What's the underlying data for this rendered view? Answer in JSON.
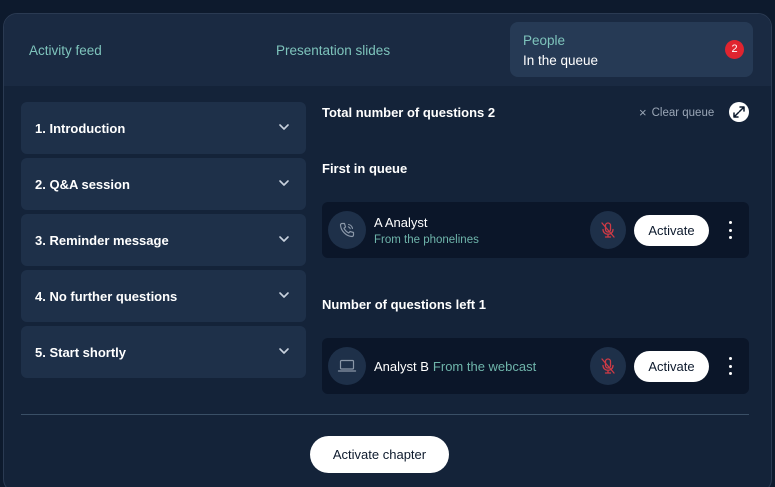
{
  "tabs": {
    "activity": "Activity feed",
    "slides": "Presentation slides",
    "people_title": "People",
    "people_subtitle": "In the queue",
    "people_badge": "2"
  },
  "chapters": [
    {
      "label": "1. Introduction"
    },
    {
      "label": "2. Q&A session"
    },
    {
      "label": "3. Reminder message"
    },
    {
      "label": "4. No further questions"
    },
    {
      "label": "5. Start shortly"
    }
  ],
  "queue": {
    "total_label": "Total number of questions 2",
    "clear_label": "Clear queue",
    "first_label": "First in queue",
    "left_label": "Number of questions left 1",
    "items": [
      {
        "name": "A Analyst",
        "source": "From the phonelines",
        "icon": "phone-icon",
        "action": "Activate"
      },
      {
        "name": "Analyst B",
        "source": "From the webcast",
        "icon": "laptop-icon",
        "action": "Activate"
      }
    ]
  },
  "footer": {
    "activate_chapter": "Activate chapter"
  },
  "colors": {
    "accent_teal": "#7ec4bc",
    "badge_red": "#e0242f",
    "muted_mic_red": "#d03a45"
  }
}
